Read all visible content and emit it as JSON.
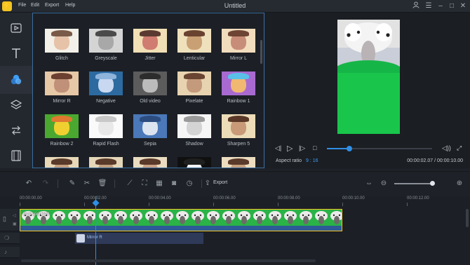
{
  "app": {
    "logo_glyph": "⚡",
    "title": "Untitled",
    "menu": [
      "File",
      "Edit",
      "Export",
      "Help"
    ]
  },
  "colors": {
    "accent": "#2f8fe6",
    "logo": "#f3c521",
    "green_screen": "#19c64b",
    "panel_border": "#3a6ea0"
  },
  "sidebar": {
    "items": [
      {
        "name": "media",
        "icon": "media-icon"
      },
      {
        "name": "text",
        "icon": "text-icon"
      },
      {
        "name": "filters",
        "icon": "filters-icon",
        "active": true
      },
      {
        "name": "overlays",
        "icon": "layers-icon"
      },
      {
        "name": "transitions",
        "icon": "transitions-icon"
      },
      {
        "name": "elements",
        "icon": "film-icon"
      }
    ]
  },
  "effects": [
    {
      "label": "Glitch",
      "bg": "#f2f0e8",
      "face": "#e6c2a8",
      "hat": "#7a5a48"
    },
    {
      "label": "Greyscale",
      "bg": "#d4d4d4",
      "face": "#a8a8a8",
      "hat": "#4a4a4a"
    },
    {
      "label": "Jitter",
      "bg": "#f1dfb6",
      "face": "#d07c70",
      "hat": "#5a3a30"
    },
    {
      "label": "Lenticular",
      "bg": "#f0e1bd",
      "face": "#c9a074",
      "hat": "#6a4330"
    },
    {
      "label": "Mirror L",
      "bg": "#f1dcbe",
      "face": "#c88d78",
      "hat": "#6e4434"
    },
    {
      "label": "Mirror R",
      "bg": "#e6c8a6",
      "face": "#c09078",
      "hat": "#6b4030"
    },
    {
      "label": "Negative",
      "bg": "#2c6aa0",
      "face": "#c8d8f0",
      "hat": "#8eb4dc"
    },
    {
      "label": "Old video",
      "bg": "#5c5c5c",
      "face": "#bcbcbc",
      "hat": "#2c2c2c"
    },
    {
      "label": "Pixelate",
      "bg": "#e8d3b0",
      "face": "#c49a7c",
      "hat": "#6a4432"
    },
    {
      "label": "Rainbow 1",
      "bg": "#a86ad0",
      "face": "#f0b870",
      "hat": "#5ac0e8"
    },
    {
      "label": "Rainbow 2",
      "bg": "#4aa830",
      "face": "#f0d030",
      "hat": "#e07830"
    },
    {
      "label": "Rapid Flash",
      "bg": "#fafafa",
      "face": "#e8e8e8",
      "hat": "#c8c8c8"
    },
    {
      "label": "Sepia",
      "bg": "#4a78b8",
      "face": "#dce4f0",
      "hat": "#2c4c80"
    },
    {
      "label": "Shadow",
      "bg": "#f6f6f6",
      "face": "#d4d4d4",
      "hat": "#9a9a9a"
    },
    {
      "label": "Sharpen 5",
      "bg": "#ecdcb8",
      "face": "#c89a78",
      "hat": "#5a3828"
    },
    {
      "label": "",
      "bg": "#e8d8b8",
      "face": "#c8a080",
      "hat": "#5a3a2a"
    },
    {
      "label": "",
      "bg": "#e4d6b8",
      "face": "#c2a080",
      "hat": "#5a3a2a"
    },
    {
      "label": "",
      "bg": "#eadcc0",
      "face": "#caa286",
      "hat": "#5a3a2a"
    },
    {
      "label": "",
      "bg": "#101010",
      "face": "#f4f4f4",
      "hat": "#202020"
    },
    {
      "label": "",
      "bg": "#ecdcc0",
      "face": "#c8a080",
      "hat": "#5a3a2a"
    }
  ],
  "player": {
    "progress": 0.21,
    "aspect_label": "Aspect ratio",
    "aspect_value": "9 : 16",
    "time": "00:00:02.07 / 00:00:10.00"
  },
  "toolbar": {
    "export_label": "Export"
  },
  "timeline": {
    "ruler": [
      "00:00:00.00",
      "00:00:02.00",
      "00:00:04.00",
      "00:00:06.00",
      "00:00:08.00",
      "00:00:10.00",
      "00:00:12.00"
    ],
    "clip_label": "Bowlsprinkled",
    "effect_clip_label": "Mirror R"
  }
}
